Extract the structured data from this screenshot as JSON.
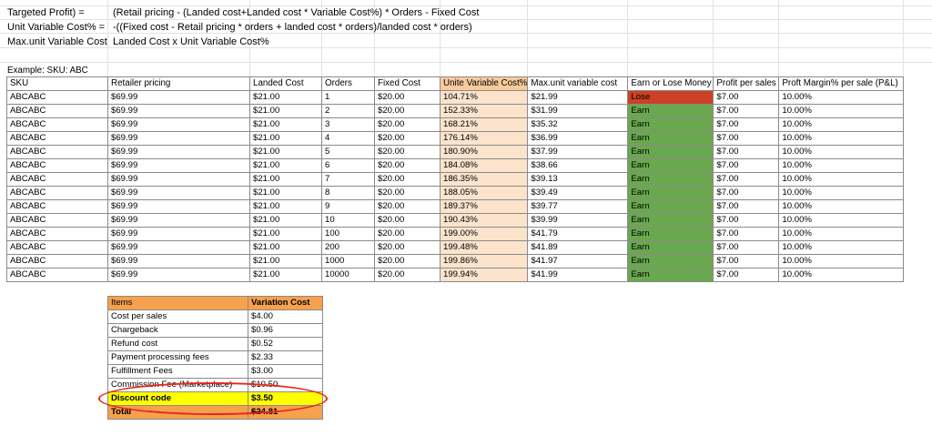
{
  "formulas": [
    {
      "label": "Targeted Profit) =",
      "value": "(Retail pricing - (Landed cost+Landed cost * Variable Cost%) * Orders - Fixed Cost"
    },
    {
      "label": "Unit Variable Cost% =",
      "value": "-((Fixed cost - Retail pricing * orders + landed cost * orders)/landed cost * orders)"
    },
    {
      "label": "Max.unit Variable Cost",
      "value": "Landed Cost x Unit Variable Cost%"
    }
  ],
  "example_label": "Example: SKU: ABC",
  "table": {
    "headers": [
      "SKU",
      "Retailer pricing",
      "Landed Cost",
      "Orders",
      "Fixed Cost",
      "Unite Variable Cost%",
      "Max.unit variable cost",
      "Earn or Lose Money",
      "Profit per sales",
      "Proft Margin% per sale (P&L)"
    ],
    "rows": [
      [
        "ABCABC",
        "$69.99",
        "$21.00",
        "1",
        "$20.00",
        "104.71%",
        "$21.99",
        "Lose",
        "$7.00",
        "10.00%"
      ],
      [
        "ABCABC",
        "$69.99",
        "$21.00",
        "2",
        "$20.00",
        "152.33%",
        "$31.99",
        "Earn",
        "$7.00",
        "10.00%"
      ],
      [
        "ABCABC",
        "$69.99",
        "$21.00",
        "3",
        "$20.00",
        "168.21%",
        "$35.32",
        "Earn",
        "$7.00",
        "10.00%"
      ],
      [
        "ABCABC",
        "$69.99",
        "$21.00",
        "4",
        "$20.00",
        "176.14%",
        "$36.99",
        "Earn",
        "$7.00",
        "10.00%"
      ],
      [
        "ABCABC",
        "$69.99",
        "$21.00",
        "5",
        "$20.00",
        "180.90%",
        "$37.99",
        "Earn",
        "$7.00",
        "10.00%"
      ],
      [
        "ABCABC",
        "$69.99",
        "$21.00",
        "6",
        "$20.00",
        "184.08%",
        "$38.66",
        "Earn",
        "$7.00",
        "10.00%"
      ],
      [
        "ABCABC",
        "$69.99",
        "$21.00",
        "7",
        "$20.00",
        "186.35%",
        "$39.13",
        "Earn",
        "$7.00",
        "10.00%"
      ],
      [
        "ABCABC",
        "$69.99",
        "$21.00",
        "8",
        "$20.00",
        "188.05%",
        "$39.49",
        "Earn",
        "$7.00",
        "10.00%"
      ],
      [
        "ABCABC",
        "$69.99",
        "$21.00",
        "9",
        "$20.00",
        "189.37%",
        "$39.77",
        "Earn",
        "$7.00",
        "10.00%"
      ],
      [
        "ABCABC",
        "$69.99",
        "$21.00",
        "10",
        "$20.00",
        "190.43%",
        "$39.99",
        "Earn",
        "$7.00",
        "10.00%"
      ],
      [
        "ABCABC",
        "$69.99",
        "$21.00",
        "100",
        "$20.00",
        "199.00%",
        "$41.79",
        "Earn",
        "$7.00",
        "10.00%"
      ],
      [
        "ABCABC",
        "$69.99",
        "$21.00",
        "200",
        "$20.00",
        "199.48%",
        "$41.89",
        "Earn",
        "$7.00",
        "10.00%"
      ],
      [
        "ABCABC",
        "$69.99",
        "$21.00",
        "1000",
        "$20.00",
        "199.86%",
        "$41.97",
        "Earn",
        "$7.00",
        "10.00%"
      ],
      [
        "ABCABC",
        "$69.99",
        "$21.00",
        "10000",
        "$20.00",
        "199.94%",
        "$41.99",
        "Earn",
        "$7.00",
        "10.00%"
      ]
    ]
  },
  "cost_table": {
    "headers": [
      "Items",
      "Variation Cost"
    ],
    "rows": [
      [
        "Cost per sales",
        "$4.00"
      ],
      [
        "Chargeback",
        "$0.96"
      ],
      [
        "Refund cost",
        "$0.52"
      ],
      [
        "Payment processing fees",
        "$2.33"
      ],
      [
        "Fulfillment Fees",
        "$3.00"
      ],
      [
        "Commission Fee (Marketplace)",
        "$10.50"
      ],
      [
        "Discount code",
        "$3.50"
      ],
      [
        "Total",
        "$24.81"
      ]
    ]
  },
  "colors": {
    "header_variable_cost": "#f9cb9c",
    "variable_cost_cells": "#fbe3cc",
    "lose": "#cc4125",
    "earn": "#6aa84f",
    "cost_header": "#f6a14d",
    "highlight": "#ffff00",
    "annotation_oval": "#e8271e"
  }
}
